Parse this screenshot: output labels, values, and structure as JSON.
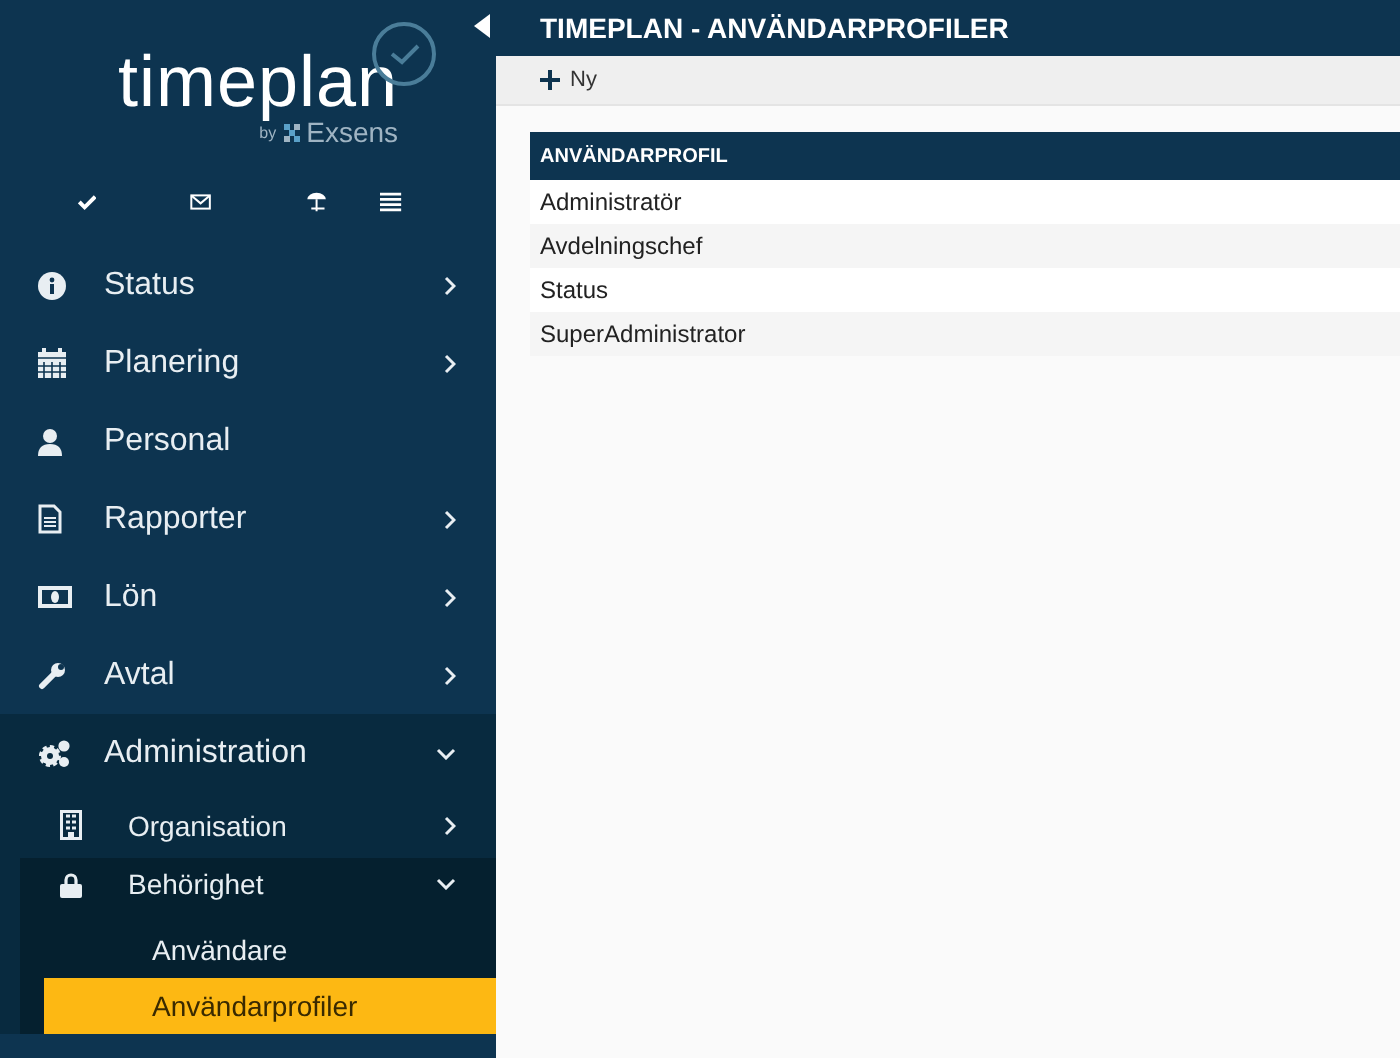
{
  "logo": {
    "name": "timeplan",
    "byline_prefix": "by",
    "byline_brand": "Exsens"
  },
  "menu": [
    {
      "label": "Status",
      "expanded": false
    },
    {
      "label": "Planering",
      "expanded": false
    },
    {
      "label": "Personal"
    },
    {
      "label": "Rapporter",
      "expanded": false
    },
    {
      "label": "Lön",
      "expanded": false
    },
    {
      "label": "Avtal",
      "expanded": false
    },
    {
      "label": "Administration",
      "expanded": true,
      "children": [
        {
          "label": "Organisation",
          "expanded": false
        },
        {
          "label": "Behörighet",
          "expanded": true,
          "children": [
            {
              "label": "Användare",
              "selected": false
            },
            {
              "label": "Användarprofiler",
              "selected": true
            }
          ]
        }
      ]
    }
  ],
  "header": {
    "title": "TIMEPLAN - ANVÄNDARPROFILER"
  },
  "toolbar": {
    "new_button": "Ny"
  },
  "table": {
    "columns": [
      "ANVÄNDARPROFIL"
    ],
    "rows": [
      "Administratör",
      "Avdelningschef",
      "Status",
      "SuperAdministrator"
    ]
  }
}
